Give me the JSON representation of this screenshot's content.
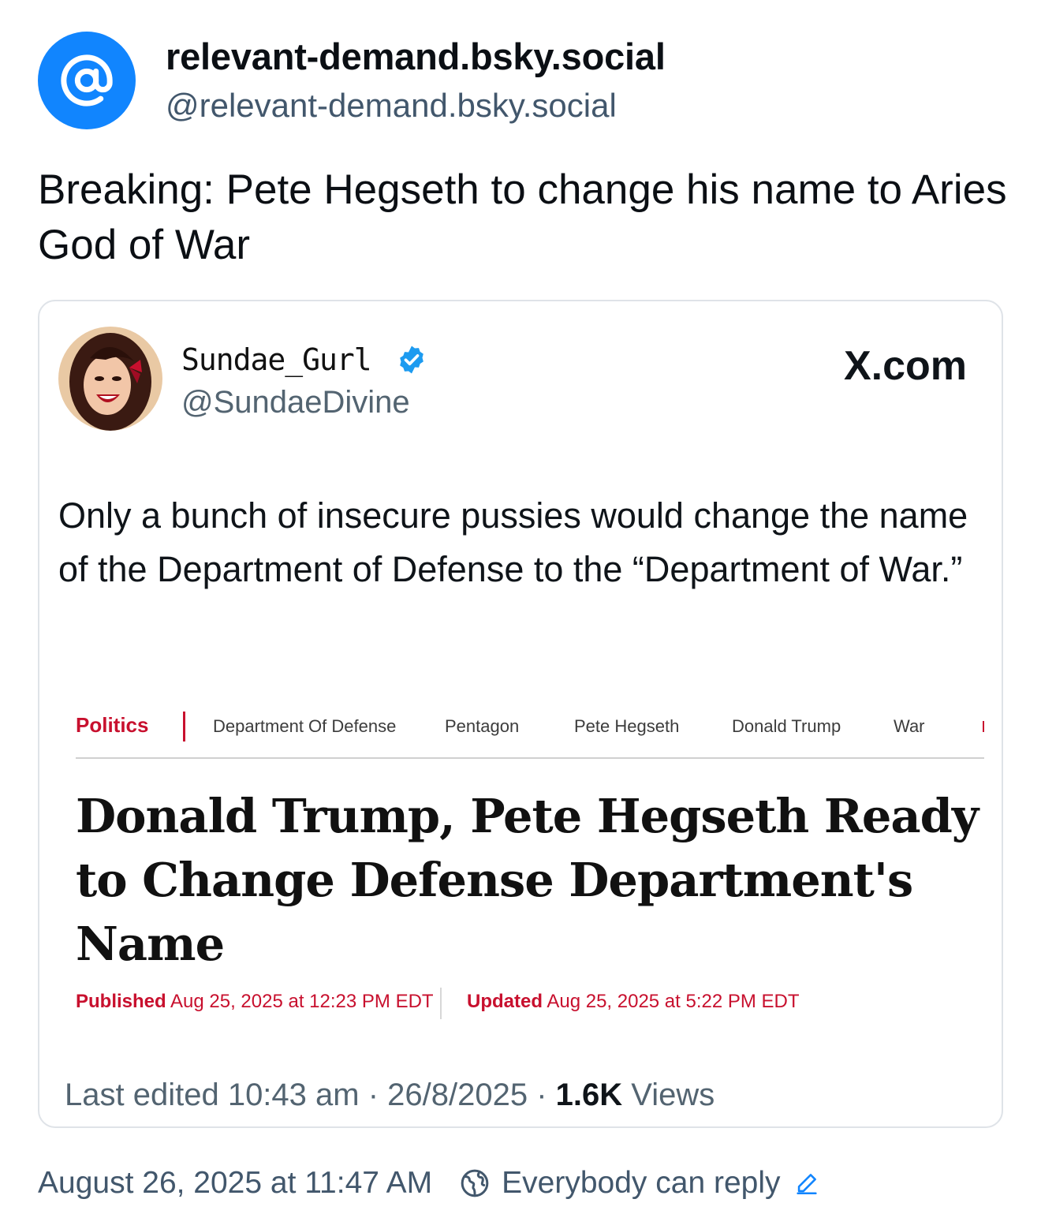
{
  "author": {
    "display_name": "relevant-demand.bsky.social",
    "handle": "@relevant-demand.bsky.social",
    "avatar_icon": "at-sign-icon",
    "avatar_color": "#1185fe"
  },
  "post": {
    "text": "Breaking:  Pete Hegseth to change his name to Aries God of War"
  },
  "embed": {
    "author_name": "Sundae_Gurl",
    "author_handle": "@SundaeDivine",
    "verified_icon": "verified-badge-icon",
    "source": "X.com",
    "text": "Only a bunch of insecure pussies would change the name of the Department of Defense to the “Department of War.”",
    "article": {
      "category": "Politics",
      "tags": [
        "Department Of Defense",
        "Pentagon",
        "Pete Hegseth",
        "Donald Trump",
        "War"
      ],
      "headline": "Donald Trump, Pete Hegseth Ready to Change Defense Department's Name",
      "published_label": "Published",
      "published_date": "Aug 25, 2025 at 12:23 PM EDT",
      "updated_label": "Updated",
      "updated_date": "Aug 25, 2025 at 5:22 PM EDT",
      "accent_color": "#c8102e"
    },
    "meta": {
      "edited": "Last edited 10:43 am · 26/8/2025",
      "separator": " ·",
      "views_count": "1.6K",
      "views_label": "Views"
    }
  },
  "footer": {
    "timestamp": "August 26, 2025 at 11:47 AM",
    "reply_setting": "Everybody can reply",
    "globe_icon": "globe-icon",
    "edit_icon": "pencil-icon"
  }
}
